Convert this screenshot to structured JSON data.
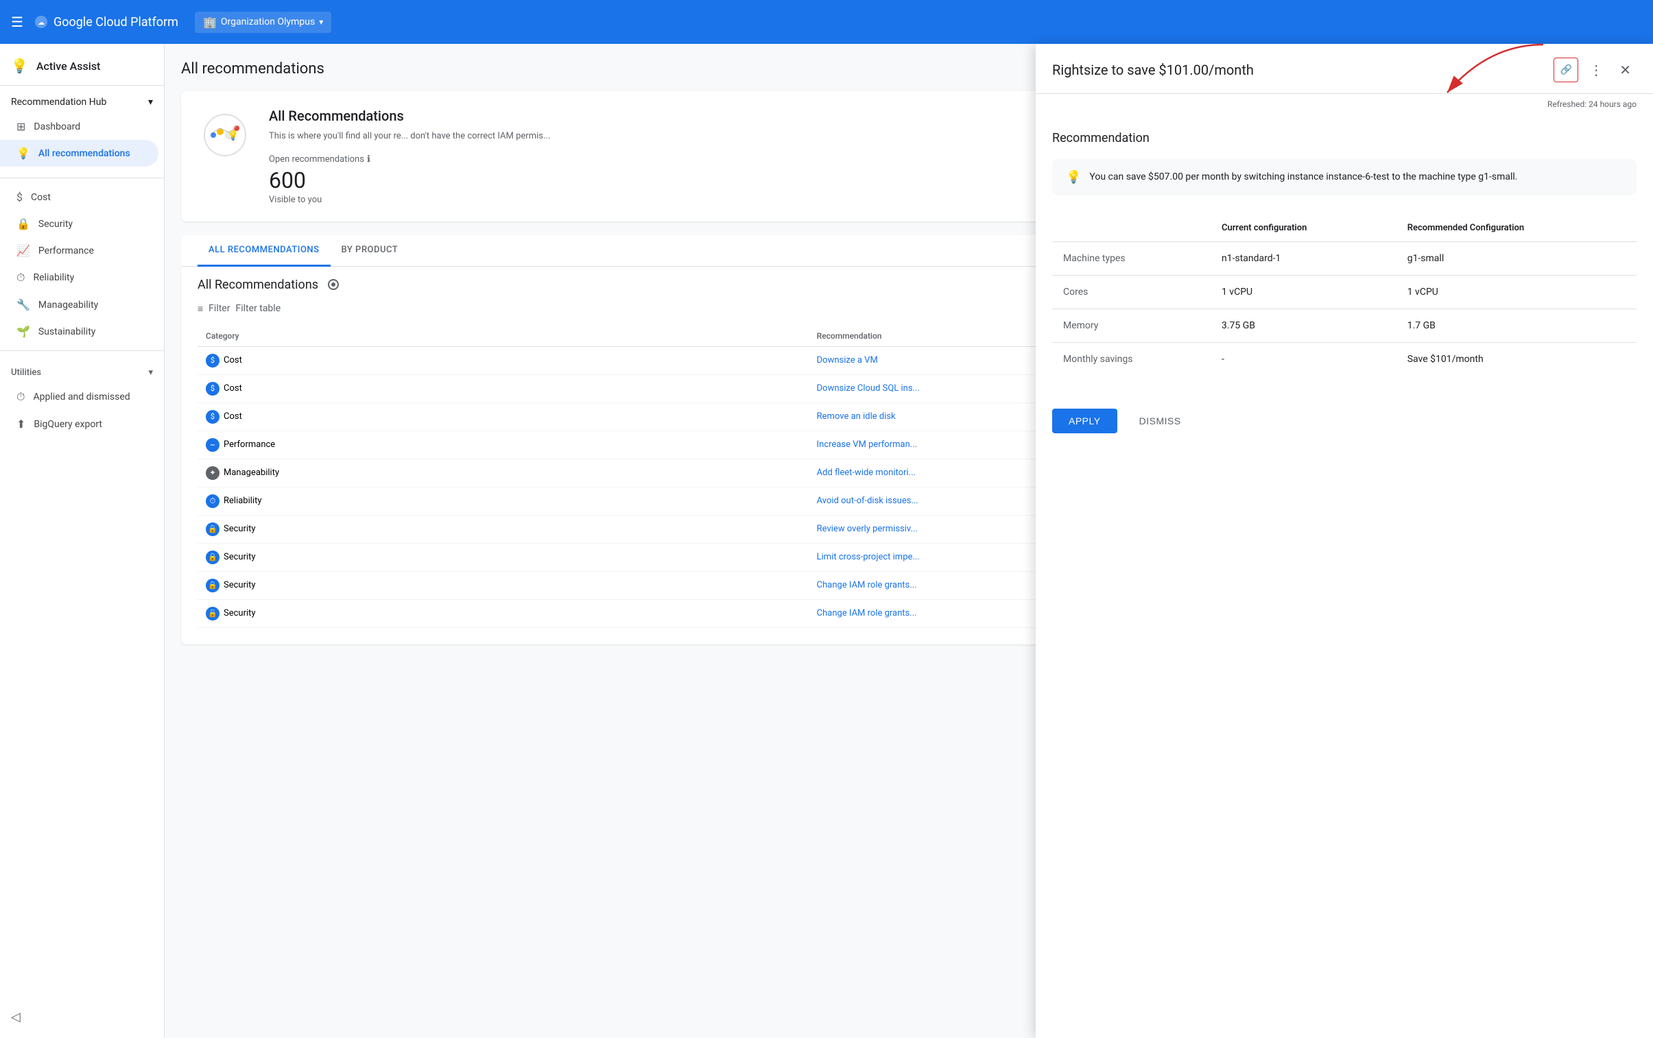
{
  "topNav": {
    "hamburger_label": "☰",
    "logo": "Google Cloud Platform",
    "org_icon": "🏢",
    "org_name": "Organization Olympus",
    "chevron": "▾"
  },
  "sidebar": {
    "active_assist_label": "Active Assist",
    "sections": {
      "recommendation_hub": {
        "label": "Recommendation Hub",
        "chevron": "▾",
        "items": [
          {
            "id": "dashboard",
            "label": "Dashboard",
            "icon": "⊞"
          },
          {
            "id": "all-recommendations",
            "label": "All recommendations",
            "icon": "💡",
            "active": true
          }
        ]
      },
      "categories": [
        {
          "id": "cost",
          "label": "Cost",
          "icon": "$"
        },
        {
          "id": "security",
          "label": "Security",
          "icon": "🔒"
        },
        {
          "id": "performance",
          "label": "Performance",
          "icon": "📈"
        },
        {
          "id": "reliability",
          "label": "Reliability",
          "icon": "⏱"
        },
        {
          "id": "manageability",
          "label": "Manageability",
          "icon": "🔧"
        },
        {
          "id": "sustainability",
          "label": "Sustainability",
          "icon": "🌱"
        }
      ]
    },
    "utilities": {
      "label": "Utilities",
      "chevron": "▾",
      "items": [
        {
          "id": "applied-dismissed",
          "label": "Applied and dismissed",
          "icon": "⏱"
        },
        {
          "id": "bigquery-export",
          "label": "BigQuery export",
          "icon": "⬆"
        }
      ]
    }
  },
  "mainContent": {
    "title": "All recommendations",
    "summaryCard": {
      "title": "All Recommendations",
      "description": "This is where you'll find all your re... don't have the correct IAM permis...",
      "open_recs_label": "Open recommendations",
      "open_recs_count": "600",
      "visible_label": "Visible to you"
    },
    "tabs": [
      {
        "id": "all",
        "label": "ALL RECOMMENDATIONS",
        "active": true
      },
      {
        "id": "by-product",
        "label": "BY PRODUCT"
      }
    ],
    "allRecsTitle": "All Recommendations",
    "filterLabel": "Filter",
    "filterTableLabel": "Filter table",
    "tableHeaders": [
      "Category",
      "Recommendation"
    ],
    "rows": [
      {
        "category": "Cost",
        "categoryType": "cost",
        "recommendation": "Downsize a VM"
      },
      {
        "category": "Cost",
        "categoryType": "cost",
        "recommendation": "Downsize Cloud SQL ins..."
      },
      {
        "category": "Cost",
        "categoryType": "cost",
        "recommendation": "Remove an idle disk"
      },
      {
        "category": "Performance",
        "categoryType": "perf",
        "recommendation": "Increase VM performan..."
      },
      {
        "category": "Manageability",
        "categoryType": "manage",
        "recommendation": "Add fleet-wide monitori..."
      },
      {
        "category": "Reliability",
        "categoryType": "reliability",
        "recommendation": "Avoid out-of-disk issues..."
      },
      {
        "category": "Security",
        "categoryType": "security",
        "recommendation": "Review overly permissiv..."
      },
      {
        "category": "Security",
        "categoryType": "security",
        "recommendation": "Limit cross-project impe..."
      },
      {
        "category": "Security",
        "categoryType": "security",
        "recommendation": "Change IAM role grants..."
      },
      {
        "category": "Security",
        "categoryType": "security",
        "recommendation": "Change IAM role grants..."
      }
    ]
  },
  "panel": {
    "title": "Rightsize to save $101.00/month",
    "refreshed": "Refreshed: 24 hours ago",
    "section_title": "Recommendation",
    "info_text": "You can save $507.00 per month by switching instance instance-6-test to the machine type g1-small.",
    "config_table": {
      "headers": [
        "",
        "Current configuration",
        "Recommended Configuration"
      ],
      "rows": [
        {
          "label": "Machine types",
          "current": "n1-standard-1",
          "recommended": "g1-small"
        },
        {
          "label": "Cores",
          "current": "1 vCPU",
          "recommended": "1 vCPU"
        },
        {
          "label": "Memory",
          "current": "3.75 GB",
          "recommended": "1.7 GB"
        },
        {
          "label": "Monthly savings",
          "current": "-",
          "recommended": "Save $101/month"
        }
      ]
    },
    "apply_label": "APPLY",
    "dismiss_label": "DISMISS"
  },
  "icons": {
    "menu": "☰",
    "bulb": "💡",
    "link": "🔗",
    "kebab": "⋮",
    "close": "✕",
    "info": "ℹ",
    "filter": "≡",
    "collapse": "◁"
  }
}
